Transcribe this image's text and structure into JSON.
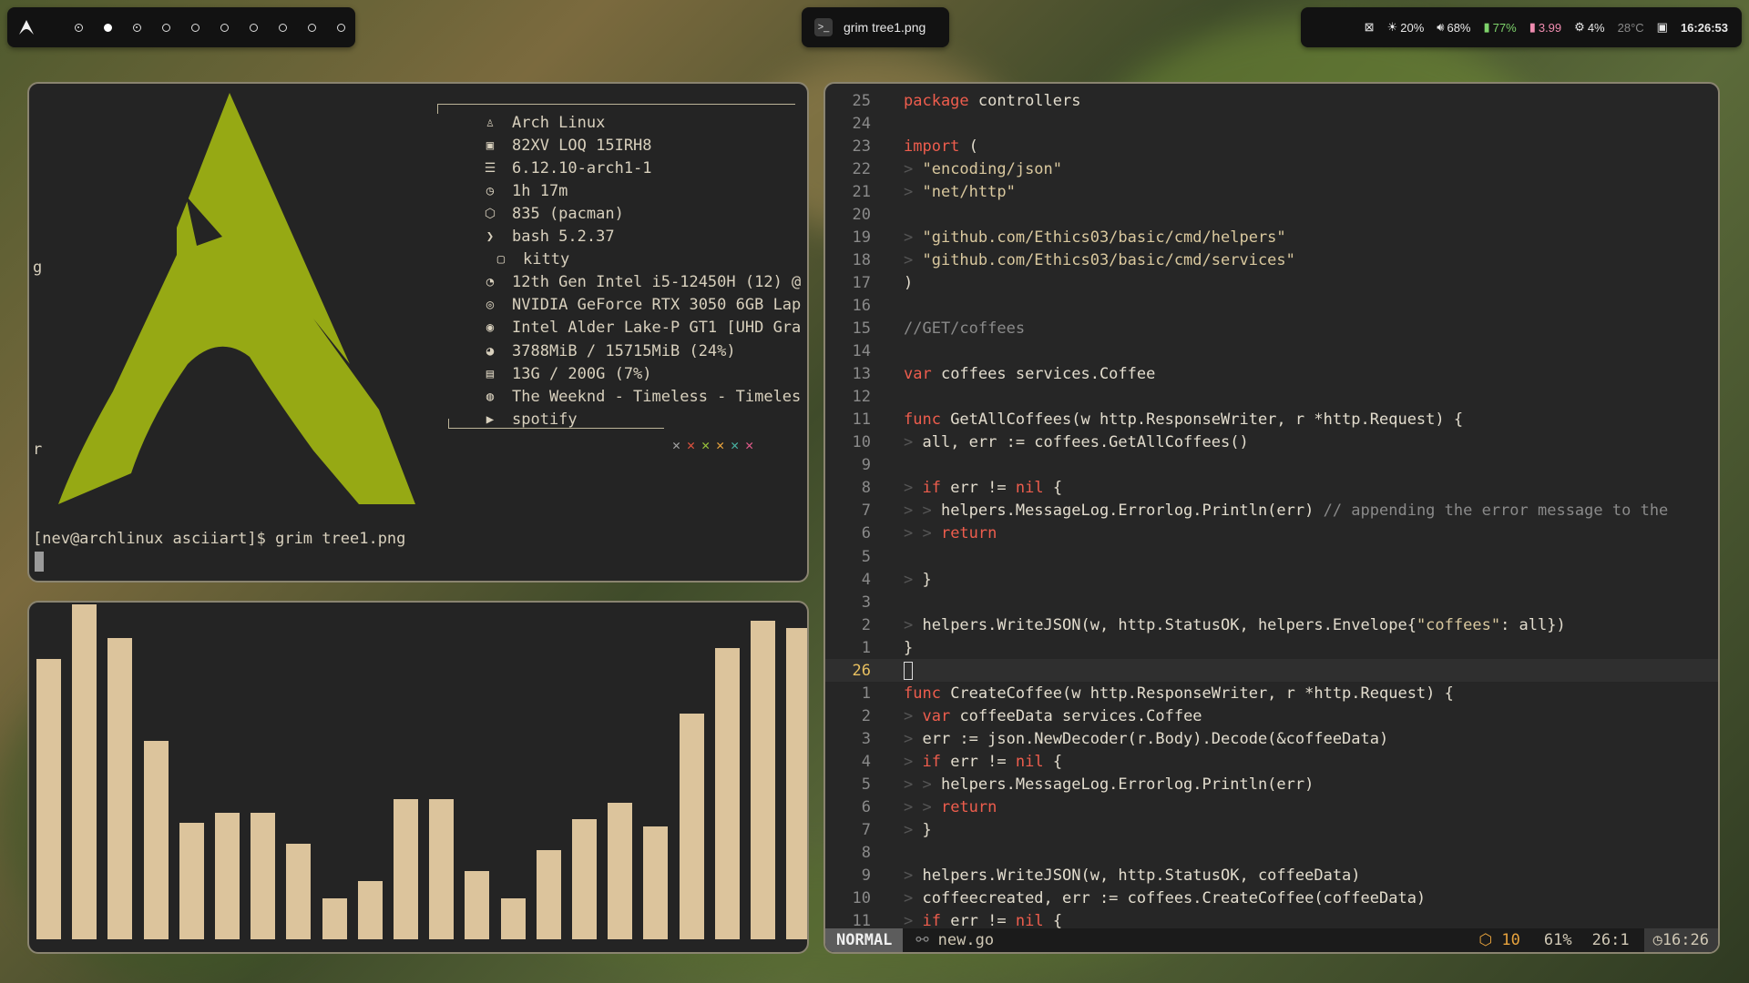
{
  "topbar": {
    "launcher_icon": "arch-logo-icon",
    "workspaces": [
      "focus",
      "filled",
      "focus",
      "empty",
      "empty",
      "empty",
      "empty",
      "empty",
      "empty",
      "empty"
    ],
    "active_window_title": "grim tree1.png",
    "status": {
      "brightness": "20%",
      "volume": "68%",
      "battery": "77%",
      "power": "3.99",
      "cpu": "4%",
      "temp": "28°C",
      "clock": "16:26:53"
    },
    "colors": {
      "battery": "#7ed36b",
      "power": "#f08cb0"
    }
  },
  "fastfetch": {
    "rows": [
      {
        "icon": "linux-icon",
        "glyph": "♙",
        "text": "Arch Linux"
      },
      {
        "icon": "laptop-icon",
        "glyph": "▣",
        "text": "82XV LOQ 15IRH8"
      },
      {
        "icon": "kernel-icon",
        "glyph": "☰",
        "text": "6.12.10-arch1-1"
      },
      {
        "icon": "clock-icon",
        "glyph": "◷",
        "text": "1h 17m"
      },
      {
        "icon": "package-icon",
        "glyph": "⬡",
        "text": "835 (pacman)"
      },
      {
        "icon": "shell-icon",
        "glyph": "❯",
        "text": "bash 5.2.37"
      },
      {
        "icon": "terminal-icon",
        "glyph": "▢",
        "text": "kitty"
      },
      {
        "icon": "cpu-icon",
        "glyph": "◔",
        "text": "12th Gen Intel i5-12450H (12) @"
      },
      {
        "icon": "gpu-icon",
        "glyph": "◎",
        "text": "NVIDIA GeForce RTX 3050 6GB Lap"
      },
      {
        "icon": "gpu-icon",
        "glyph": "◉",
        "text": "Intel Alder Lake-P GT1 [UHD Gra"
      },
      {
        "icon": "memory-icon",
        "glyph": "◕",
        "text": "3788MiB / 15715MiB (24%)"
      },
      {
        "icon": "disk-icon",
        "glyph": "▤",
        "text": "13G / 200G (7%)"
      },
      {
        "icon": "spotify-icon",
        "glyph": "◍",
        "text": "The Weeknd - Timeless - Timeles"
      },
      {
        "icon": "play-icon",
        "glyph": "▶",
        "text": "spotify"
      }
    ],
    "color_marks": [
      "✕",
      "✕",
      "✕",
      "✕",
      "✕",
      "✕"
    ],
    "mark_colors": [
      "#a3a3a3",
      "#e0533f",
      "#98c13b",
      "#e8a33d",
      "#48b0a0",
      "#e05a8a"
    ],
    "side_letters": [
      "g",
      "r"
    ],
    "prompt": "[nev@archlinux asciiart]$ grim tree1.png"
  },
  "visualizer": {
    "levels": [
      0.82,
      0.98,
      0.88,
      0.58,
      0.34,
      0.37,
      0.37,
      0.28,
      0.12,
      0.17,
      0.41,
      0.41,
      0.2,
      0.12,
      0.26,
      0.35,
      0.4,
      0.33,
      0.66,
      0.85,
      0.93,
      0.91
    ]
  },
  "editor": {
    "lines": [
      {
        "n": "25",
        "tokens": [
          [
            "kw",
            "package"
          ],
          [
            "id",
            " controllers"
          ]
        ]
      },
      {
        "n": "24",
        "tokens": []
      },
      {
        "n": "23",
        "tokens": [
          [
            "kw",
            "import"
          ],
          [
            "id",
            " ("
          ]
        ]
      },
      {
        "n": "22",
        "tokens": [
          [
            "ind",
            "> "
          ],
          [
            "str",
            "\"encoding/json\""
          ]
        ]
      },
      {
        "n": "21",
        "tokens": [
          [
            "ind",
            "> "
          ],
          [
            "str",
            "\"net/http\""
          ]
        ]
      },
      {
        "n": "20",
        "tokens": []
      },
      {
        "n": "19",
        "tokens": [
          [
            "ind",
            "> "
          ],
          [
            "str",
            "\"github.com/Ethics03/basic/cmd/helpers\""
          ]
        ]
      },
      {
        "n": "18",
        "tokens": [
          [
            "ind",
            "> "
          ],
          [
            "str",
            "\"github.com/Ethics03/basic/cmd/services\""
          ]
        ]
      },
      {
        "n": "17",
        "tokens": [
          [
            "id",
            ")"
          ]
        ]
      },
      {
        "n": "16",
        "tokens": []
      },
      {
        "n": "15",
        "tokens": [
          [
            "cm",
            "//GET/coffees"
          ]
        ]
      },
      {
        "n": "14",
        "tokens": []
      },
      {
        "n": "13",
        "tokens": [
          [
            "kw",
            "var"
          ],
          [
            "id",
            " coffees services.Coffee"
          ]
        ]
      },
      {
        "n": "12",
        "tokens": []
      },
      {
        "n": "11",
        "tokens": [
          [
            "kw",
            "func"
          ],
          [
            "id",
            " GetAllCoffees(w http.ResponseWriter, r *http.Request) {"
          ]
        ]
      },
      {
        "n": "10",
        "tokens": [
          [
            "ind",
            "> "
          ],
          [
            "id",
            "all, err := coffees.GetAllCoffees()"
          ]
        ]
      },
      {
        "n": "9",
        "tokens": []
      },
      {
        "n": "8",
        "tokens": [
          [
            "ind",
            "> "
          ],
          [
            "kw",
            "if"
          ],
          [
            "id",
            " err != "
          ],
          [
            "kw",
            "nil"
          ],
          [
            "id",
            " {"
          ]
        ]
      },
      {
        "n": "7",
        "tokens": [
          [
            "ind",
            "> > "
          ],
          [
            "id",
            "helpers.MessageLog.Errorlog.Println(err) "
          ],
          [
            "cm",
            "// appending the error message to the"
          ]
        ]
      },
      {
        "n": "6",
        "tokens": [
          [
            "ind",
            "> > "
          ],
          [
            "kw",
            "return"
          ]
        ]
      },
      {
        "n": "5",
        "tokens": []
      },
      {
        "n": "4",
        "tokens": [
          [
            "ind",
            "> "
          ],
          [
            "id",
            "}"
          ]
        ]
      },
      {
        "n": "3",
        "tokens": []
      },
      {
        "n": "2",
        "tokens": [
          [
            "ind",
            "> "
          ],
          [
            "id",
            "helpers.WriteJSON(w, http.StatusOK, helpers.Envelope{"
          ],
          [
            "str",
            "\"coffees\""
          ],
          [
            "id",
            ": all})"
          ]
        ]
      },
      {
        "n": "1",
        "tokens": [
          [
            "id",
            "}"
          ]
        ]
      },
      {
        "n": "26",
        "tokens": [],
        "current": true
      },
      {
        "n": "1",
        "tokens": [
          [
            "kw",
            "func"
          ],
          [
            "id",
            " CreateCoffee(w http.ResponseWriter, r *http.Request) {"
          ]
        ]
      },
      {
        "n": "2",
        "tokens": [
          [
            "ind",
            "> "
          ],
          [
            "kw",
            "var"
          ],
          [
            "id",
            " coffeeData services.Coffee"
          ]
        ]
      },
      {
        "n": "3",
        "tokens": [
          [
            "ind",
            "> "
          ],
          [
            "id",
            "err := json.NewDecoder(r.Body).Decode(&coffeeData)"
          ]
        ]
      },
      {
        "n": "4",
        "tokens": [
          [
            "ind",
            "> "
          ],
          [
            "kw",
            "if"
          ],
          [
            "id",
            " err != "
          ],
          [
            "kw",
            "nil"
          ],
          [
            "id",
            " {"
          ]
        ]
      },
      {
        "n": "5",
        "tokens": [
          [
            "ind",
            "> > "
          ],
          [
            "id",
            "helpers.MessageLog.Errorlog.Println(err)"
          ]
        ]
      },
      {
        "n": "6",
        "tokens": [
          [
            "ind",
            "> > "
          ],
          [
            "kw",
            "return"
          ]
        ]
      },
      {
        "n": "7",
        "tokens": [
          [
            "ind",
            "> "
          ],
          [
            "id",
            "}"
          ]
        ]
      },
      {
        "n": "8",
        "tokens": []
      },
      {
        "n": "9",
        "tokens": [
          [
            "ind",
            "> "
          ],
          [
            "id",
            "helpers.WriteJSON(w, http.StatusOK, coffeeData)"
          ]
        ]
      },
      {
        "n": "10",
        "tokens": [
          [
            "ind",
            "> "
          ],
          [
            "id",
            "coffeecreated, err := coffees.CreateCoffee(coffeeData)"
          ]
        ]
      },
      {
        "n": "11",
        "tokens": [
          [
            "ind",
            "> "
          ],
          [
            "kw",
            "if"
          ],
          [
            "id",
            " err != "
          ],
          [
            "kw",
            "nil"
          ],
          [
            "id",
            " {"
          ]
        ]
      }
    ],
    "statusline": {
      "mode": "NORMAL",
      "file": "new.go",
      "diagnostics": "10",
      "percent": "61%",
      "position": "26:1",
      "time": "16:26"
    }
  }
}
